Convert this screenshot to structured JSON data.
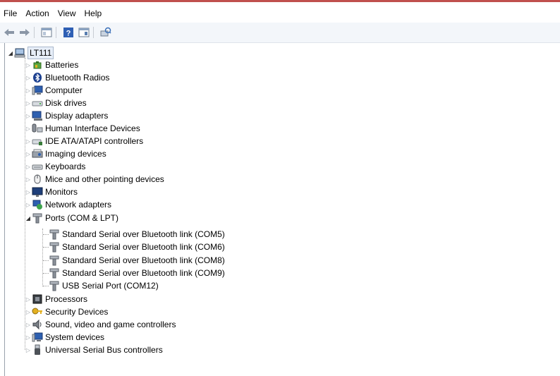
{
  "menu": [
    "File",
    "Action",
    "View",
    "Help"
  ],
  "toolbar": [
    "back-icon",
    "forward-icon",
    "properties-icon",
    "help-icon",
    "view-icon",
    "scan-hardware-icon"
  ],
  "tree": {
    "root": "LT111",
    "categories": [
      {
        "label": "Batteries",
        "icon": "battery-icon"
      },
      {
        "label": "Bluetooth Radios",
        "icon": "bluetooth-icon"
      },
      {
        "label": "Computer",
        "icon": "computer-icon"
      },
      {
        "label": "Disk drives",
        "icon": "disk-drive-icon"
      },
      {
        "label": "Display adapters",
        "icon": "display-adapter-icon"
      },
      {
        "label": "Human Interface Devices",
        "icon": "hid-icon"
      },
      {
        "label": "IDE ATA/ATAPI controllers",
        "icon": "ide-controller-icon"
      },
      {
        "label": "Imaging devices",
        "icon": "imaging-icon"
      },
      {
        "label": "Keyboards",
        "icon": "keyboard-icon"
      },
      {
        "label": "Mice and other pointing devices",
        "icon": "mouse-icon"
      },
      {
        "label": "Monitors",
        "icon": "monitor-icon"
      },
      {
        "label": "Network adapters",
        "icon": "network-icon"
      },
      {
        "label": "Ports (COM & LPT)",
        "icon": "port-icon"
      },
      {
        "label": "Processors",
        "icon": "processor-icon"
      },
      {
        "label": "Security Devices",
        "icon": "security-icon"
      },
      {
        "label": "Sound, video and game controllers",
        "icon": "sound-icon"
      },
      {
        "label": "System devices",
        "icon": "system-device-icon"
      },
      {
        "label": "Universal Serial Bus controllers",
        "icon": "usb-icon"
      }
    ],
    "ports_children": [
      "Standard Serial over Bluetooth link (COM5)",
      "Standard Serial over Bluetooth link (COM6)",
      "Standard Serial over Bluetooth link (COM8)",
      "Standard Serial over Bluetooth link (COM9)",
      "USB Serial Port (COM12)"
    ]
  },
  "colors": {
    "accent_line": "#c0504d",
    "selection": "#e7eef8",
    "toolbar_bg": "#f3f6fa"
  }
}
